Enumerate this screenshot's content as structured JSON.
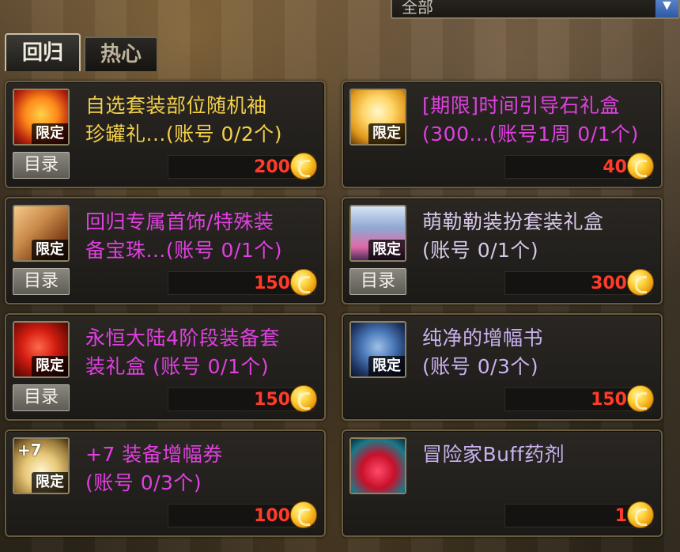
{
  "top": {
    "category_value": "全部"
  },
  "tabs": [
    {
      "label": "回归",
      "active": true
    },
    {
      "label": "热心",
      "active": false
    }
  ],
  "items": [
    {
      "name": "自选套装部位随机袖\n珍罐礼...(账号 0/2个)",
      "color": "#f2cf4a",
      "badge": "限定",
      "has_catalog": true,
      "catalog_label": "目录",
      "price": "200"
    },
    {
      "name": "[期限]时间引导石礼盒\n(300...(账号1周 0/1个)",
      "color": "#e040e0",
      "badge": "限定",
      "has_catalog": false,
      "catalog_label": "",
      "price": "40"
    },
    {
      "name": "回归专属首饰/特殊装\n备宝珠...(账号 0/1个)",
      "color": "#e040e0",
      "badge": "限定",
      "has_catalog": true,
      "catalog_label": "目录",
      "price": "150"
    },
    {
      "name": "萌勒勒装扮套装礼盒\n    (账号 0/1个)",
      "color": "#d7c8e8",
      "badge": "限定",
      "has_catalog": true,
      "catalog_label": "目录",
      "price": "300"
    },
    {
      "name": "永恒大陆4阶段装备套\n装礼盒 (账号 0/1个)",
      "color": "#e040e0",
      "badge": "限定",
      "has_catalog": true,
      "catalog_label": "目录",
      "price": "150"
    },
    {
      "name": "纯净的增幅书\n    (账号 0/3个)",
      "color": "#c9b2f0",
      "badge": "限定",
      "has_catalog": false,
      "catalog_label": "",
      "price": "150"
    },
    {
      "name": "+7 装备增幅券\n    (账号 0/3个)",
      "color": "#e040e0",
      "badge": "限定",
      "has_catalog": false,
      "catalog_label": "",
      "price": "100"
    },
    {
      "name": "冒险家Buff药剂",
      "color": "#c9b2f0",
      "badge": "",
      "has_catalog": false,
      "catalog_label": "",
      "price": "1"
    }
  ],
  "colors": {
    "price": "#ff3b2a",
    "card_border": "#6a5c3e"
  },
  "icons": [
    "gift-box-icon",
    "clock-chest-icon",
    "jewel-box-icon",
    "costume-box-icon",
    "red-helmet-box-icon",
    "amplify-book-icon",
    "plus7-ticket-icon",
    "buff-potion-icon"
  ]
}
